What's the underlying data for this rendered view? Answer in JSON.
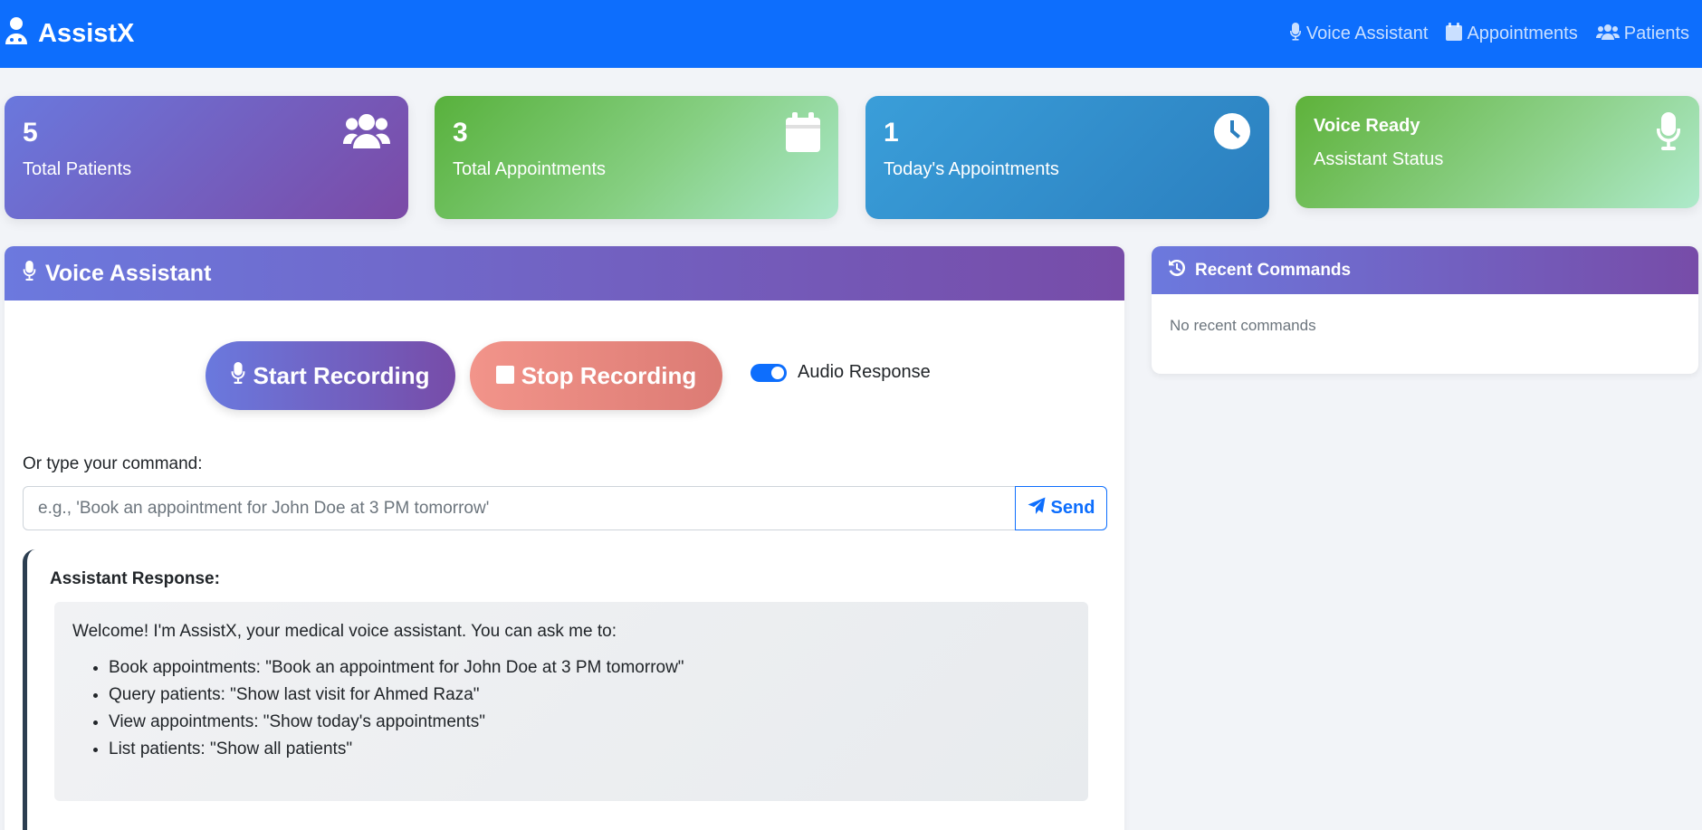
{
  "navbar": {
    "brand": "AssistX",
    "links": [
      {
        "label": "Voice Assistant",
        "icon": "microphone-icon"
      },
      {
        "label": "Appointments",
        "icon": "calendar-icon"
      },
      {
        "label": "Patients",
        "icon": "users-icon"
      }
    ]
  },
  "stats": [
    {
      "value": "5",
      "label": "Total Patients",
      "icon": "users-icon"
    },
    {
      "value": "3",
      "label": "Total Appointments",
      "icon": "calendar-icon"
    },
    {
      "value": "1",
      "label": "Today's Appointments",
      "icon": "clock-icon"
    },
    {
      "title": "Voice Ready",
      "label": "Assistant Status",
      "icon": "microphone-icon"
    }
  ],
  "voice_assistant": {
    "title": "Voice Assistant",
    "start_label": "Start Recording",
    "stop_label": "Stop Recording",
    "audio_response_label": "Audio Response",
    "audio_response_enabled": true,
    "command_label": "Or type your command:",
    "command_placeholder": "e.g., 'Book an appointment for John Doe at 3 PM tomorrow'",
    "command_value": "",
    "send_label": "Send",
    "response": {
      "title": "Assistant Response:",
      "intro": "Welcome! I'm AssistX, your medical voice assistant. You can ask me to:",
      "items": [
        "Book appointments: \"Book an appointment for John Doe at 3 PM tomorrow\"",
        "Query patients: \"Show last visit for Ahmed Raza\"",
        "View appointments: \"Show today's appointments\"",
        "List patients: \"Show all patients\""
      ]
    }
  },
  "recent_commands": {
    "title": "Recent Commands",
    "empty_text": "No recent commands"
  },
  "colors": {
    "primary": "#0d6efd",
    "purple_start": "#6a79de",
    "purple_end": "#774ca8",
    "green": "#58b13c",
    "blue": "#2b7fbf",
    "stop": "#dc7b74"
  }
}
